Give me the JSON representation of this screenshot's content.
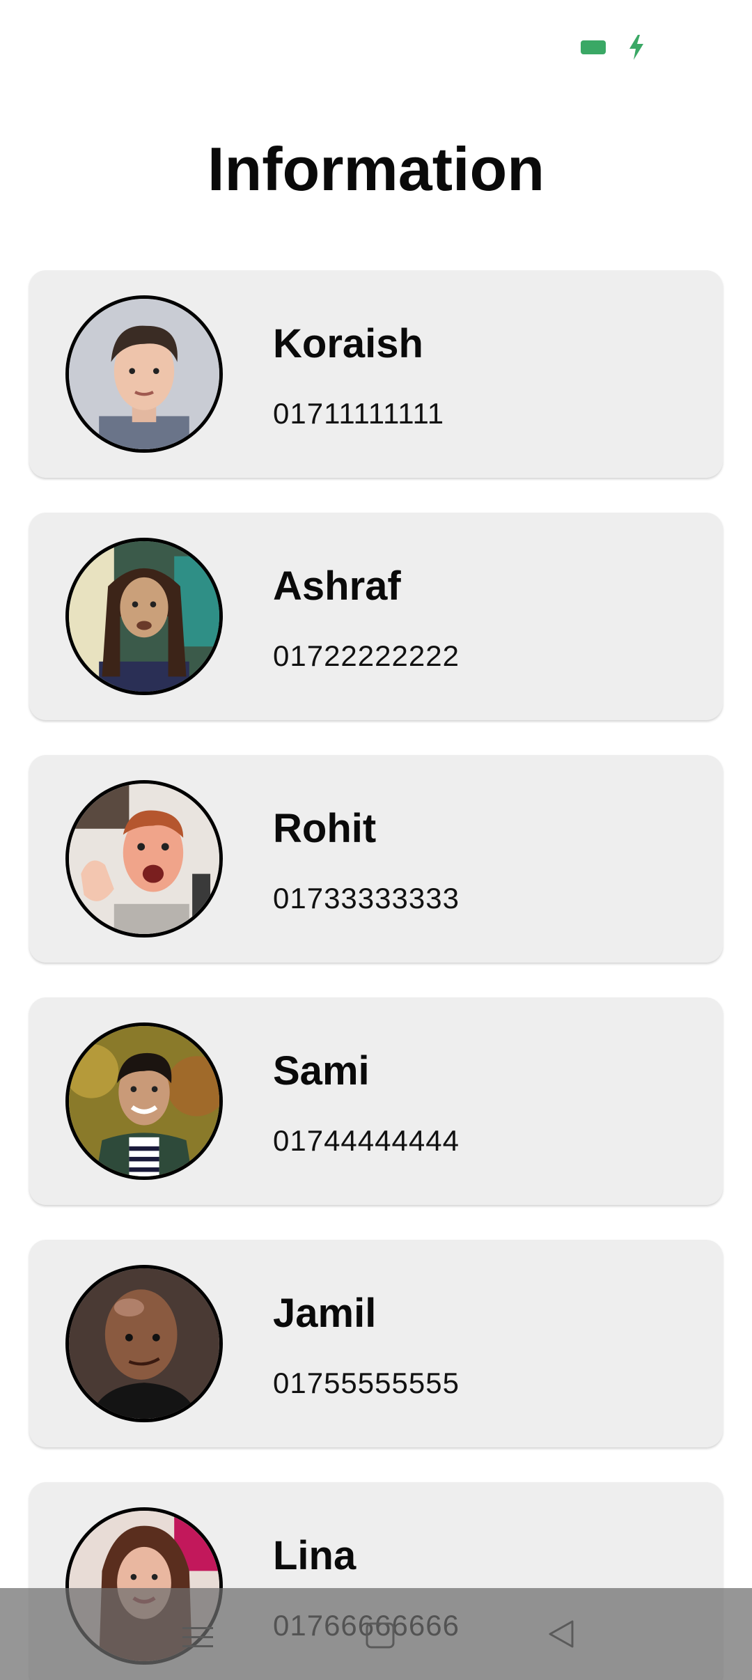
{
  "status_bar": {
    "battery_icon": "battery-icon",
    "charging_icon": "charging-bolt-icon",
    "accent_color": "#3aa865"
  },
  "header": {
    "title": "Information"
  },
  "contacts": [
    {
      "name": "Koraish",
      "phone": "01711111111",
      "avatar_icon": "avatar-photo"
    },
    {
      "name": "Ashraf",
      "phone": "01722222222",
      "avatar_icon": "avatar-photo"
    },
    {
      "name": "Rohit",
      "phone": "01733333333",
      "avatar_icon": "avatar-photo"
    },
    {
      "name": "Sami",
      "phone": "01744444444",
      "avatar_icon": "avatar-photo"
    },
    {
      "name": "Jamil",
      "phone": "01755555555",
      "avatar_icon": "avatar-photo"
    },
    {
      "name": "Lina",
      "phone": "01766666666",
      "avatar_icon": "avatar-photo"
    }
  ],
  "nav_bar": {
    "menu_icon": "menu-icon",
    "home_icon": "home-icon",
    "back_icon": "back-icon"
  }
}
